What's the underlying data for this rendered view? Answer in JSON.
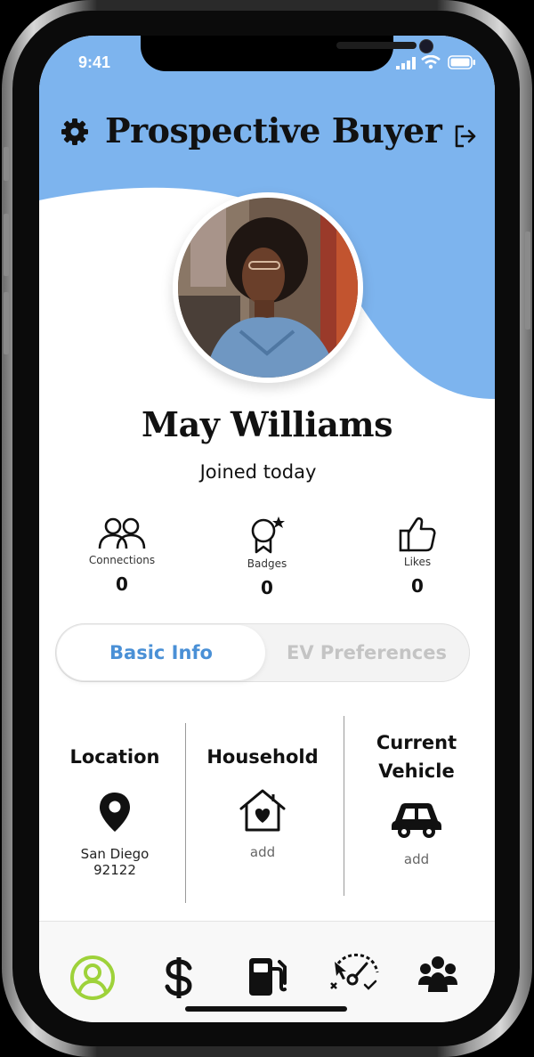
{
  "status_bar": {
    "time": "9:41"
  },
  "header": {
    "title": "Prospective Buyer",
    "settings_icon": "gear-icon",
    "logout_icon": "logout-icon",
    "accent": "#7db4ee"
  },
  "profile": {
    "name": "May Williams",
    "joined": "Joined today"
  },
  "stats": [
    {
      "label": "Connections",
      "value": "0",
      "icon": "people-icon"
    },
    {
      "label": "Badges",
      "value": "0",
      "icon": "badge-icon"
    },
    {
      "label": "Likes",
      "value": "0",
      "icon": "thumbs-up-icon"
    }
  ],
  "tabs": {
    "active": "Basic Info",
    "inactive": "EV Preferences",
    "active_color": "#4a90d6"
  },
  "info": {
    "location": {
      "title": "Location",
      "line1": "San Diego",
      "line2": "92122"
    },
    "household": {
      "title": "Household",
      "value": "add"
    },
    "vehicle": {
      "title_line1": "Current",
      "title_line2": "Vehicle",
      "value": "add"
    }
  },
  "bottom_nav": {
    "items": [
      "profile-icon",
      "dollar-icon",
      "fuel-pump-icon",
      "gauge-icon",
      "group-icon"
    ],
    "active_color": "#9ed23a"
  }
}
